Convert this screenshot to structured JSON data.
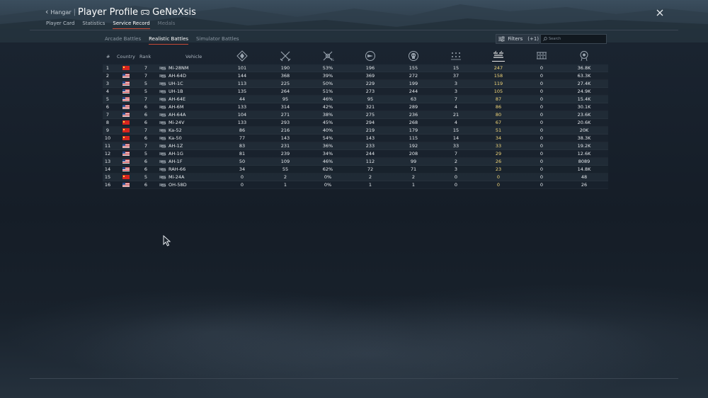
{
  "header": {
    "back_label": "Hangar",
    "separator": "|",
    "title": "Player Profile",
    "username": "GeNeXsis",
    "back_icon": "chevron-left-icon",
    "gamepad_icon": "gamepad-icon",
    "close_icon": "close-icon"
  },
  "main_tabs": [
    {
      "label": "Player Card",
      "state": "normal"
    },
    {
      "label": "Statistics",
      "state": "normal"
    },
    {
      "label": "Service Record",
      "state": "active"
    },
    {
      "label": "Medals",
      "state": "disabled"
    }
  ],
  "sub_tabs": [
    {
      "label": "Arcade Battles",
      "state": "normal"
    },
    {
      "label": "Realistic Battles",
      "state": "active"
    },
    {
      "label": "Simulator Battles",
      "state": "normal"
    }
  ],
  "filters": {
    "label": "Filters",
    "count": "(+1)",
    "icon": "sliders-icon"
  },
  "search": {
    "placeholder": "Search",
    "value": "",
    "icon": "search-icon"
  },
  "columns": {
    "num": "#",
    "country": "Country",
    "rank": "Rank",
    "vehicle": "Vehicle",
    "stat_icons": [
      "battles-icon",
      "victories-icon",
      "win-rate-icon",
      "respawns-icon",
      "deaths-icon",
      "air-targets-icon",
      "ground-targets-icon",
      "naval-targets-icon",
      "score-icon"
    ],
    "sorted_column": "ground-targets-icon"
  },
  "colors": {
    "accent": "#c94a36",
    "highlight": "#f4d87a",
    "text": "#e6eaee",
    "background": "#151d27"
  },
  "rows": [
    {
      "num": "1",
      "country": "china",
      "rank": "7",
      "vehicle": "Mi-28NM",
      "stats": [
        "101",
        "190",
        "53%",
        "196",
        "155",
        "15",
        "247",
        "0",
        "36.8K"
      ]
    },
    {
      "num": "2",
      "country": "usa",
      "rank": "7",
      "vehicle": "AH-64D",
      "stats": [
        "144",
        "368",
        "39%",
        "369",
        "272",
        "37",
        "158",
        "0",
        "63.3K"
      ]
    },
    {
      "num": "3",
      "country": "usa",
      "rank": "5",
      "vehicle": "UH-1C",
      "stats": [
        "113",
        "225",
        "50%",
        "229",
        "199",
        "3",
        "119",
        "0",
        "27.4K"
      ]
    },
    {
      "num": "4",
      "country": "usa",
      "rank": "5",
      "vehicle": "UH-1B",
      "stats": [
        "135",
        "264",
        "51%",
        "273",
        "244",
        "3",
        "105",
        "0",
        "24.9K"
      ]
    },
    {
      "num": "5",
      "country": "usa",
      "rank": "7",
      "vehicle": "AH-64E",
      "stats": [
        "44",
        "95",
        "46%",
        "95",
        "63",
        "7",
        "87",
        "0",
        "15.4K"
      ]
    },
    {
      "num": "6",
      "country": "usa",
      "rank": "6",
      "vehicle": "AH-6M",
      "stats": [
        "133",
        "314",
        "42%",
        "321",
        "289",
        "4",
        "86",
        "0",
        "30.1K"
      ]
    },
    {
      "num": "7",
      "country": "usa",
      "rank": "6",
      "vehicle": "AH-64A",
      "stats": [
        "104",
        "271",
        "38%",
        "275",
        "236",
        "21",
        "80",
        "0",
        "23.6K"
      ]
    },
    {
      "num": "8",
      "country": "china",
      "rank": "6",
      "vehicle": "Mi-24V",
      "stats": [
        "133",
        "293",
        "45%",
        "294",
        "268",
        "4",
        "67",
        "0",
        "20.6K"
      ]
    },
    {
      "num": "9",
      "country": "china",
      "rank": "7",
      "vehicle": "Ka-52",
      "stats": [
        "86",
        "216",
        "40%",
        "219",
        "179",
        "15",
        "51",
        "0",
        "20K"
      ]
    },
    {
      "num": "10",
      "country": "china",
      "rank": "6",
      "vehicle": "Ka-50",
      "stats": [
        "77",
        "143",
        "54%",
        "143",
        "115",
        "14",
        "34",
        "0",
        "38.3K"
      ]
    },
    {
      "num": "11",
      "country": "usa",
      "rank": "7",
      "vehicle": "AH-1Z",
      "stats": [
        "83",
        "231",
        "36%",
        "233",
        "192",
        "33",
        "33",
        "0",
        "19.2K"
      ]
    },
    {
      "num": "12",
      "country": "usa",
      "rank": "5",
      "vehicle": "AH-1G",
      "stats": [
        "81",
        "239",
        "34%",
        "244",
        "208",
        "7",
        "29",
        "0",
        "12.6K"
      ]
    },
    {
      "num": "13",
      "country": "usa",
      "rank": "6",
      "vehicle": "AH-1F",
      "stats": [
        "50",
        "109",
        "46%",
        "112",
        "99",
        "2",
        "26",
        "0",
        "8089"
      ]
    },
    {
      "num": "14",
      "country": "usa",
      "rank": "6",
      "vehicle": "RAH-66",
      "stats": [
        "34",
        "55",
        "62%",
        "72",
        "71",
        "3",
        "23",
        "0",
        "14.8K"
      ]
    },
    {
      "num": "15",
      "country": "china",
      "rank": "5",
      "vehicle": "Mi-24A",
      "stats": [
        "0",
        "2",
        "0%",
        "2",
        "2",
        "0",
        "0",
        "0",
        "48"
      ]
    },
    {
      "num": "16",
      "country": "usa",
      "rank": "6",
      "vehicle": "OH-58D",
      "stats": [
        "0",
        "1",
        "0%",
        "1",
        "1",
        "0",
        "0",
        "0",
        "26"
      ]
    }
  ]
}
